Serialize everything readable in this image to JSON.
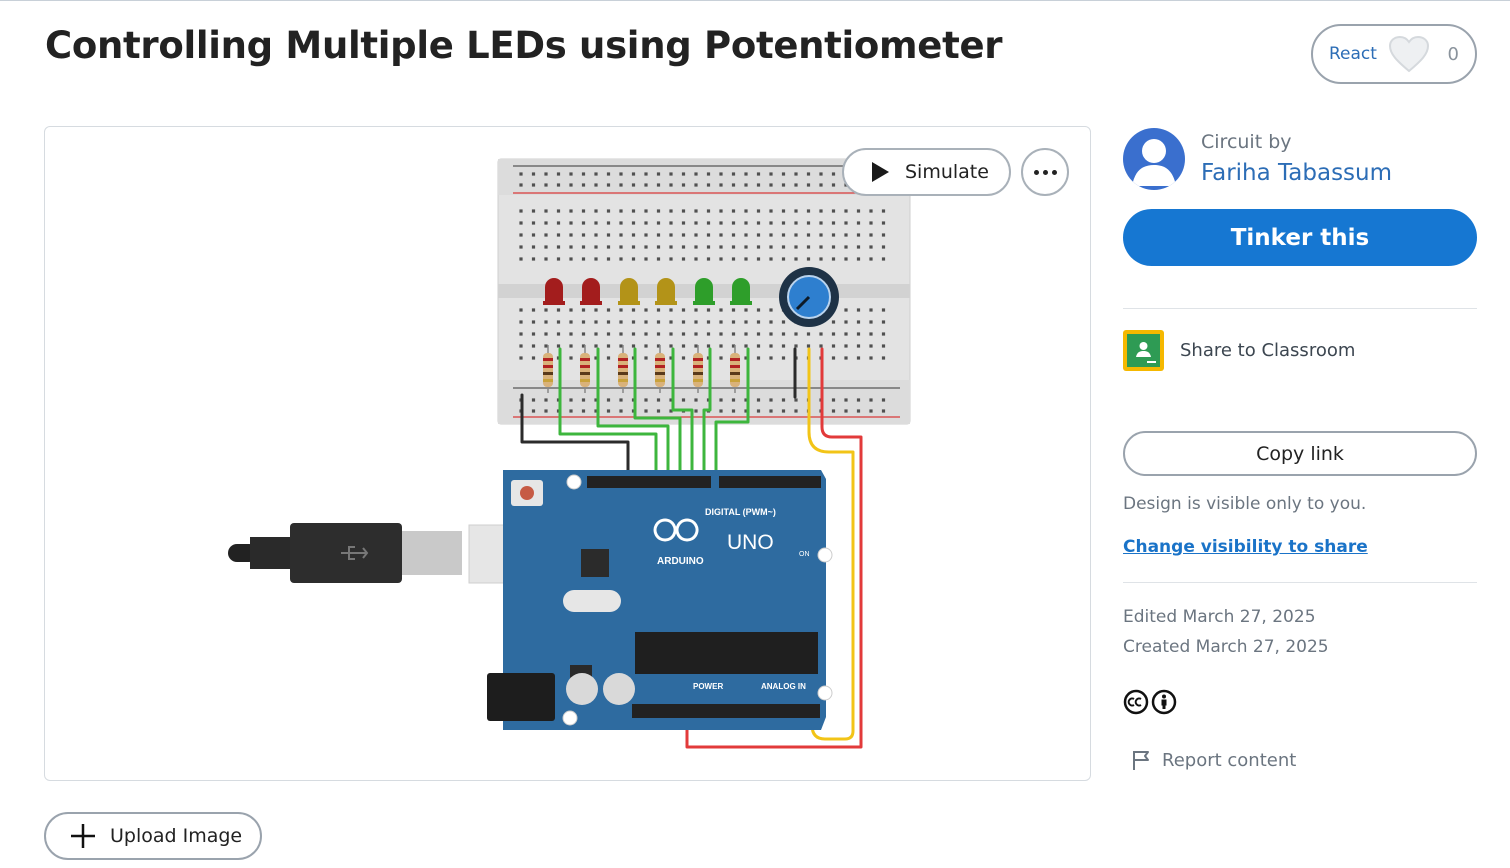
{
  "page": {
    "title": "Controlling Multiple LEDs using Potentiometer"
  },
  "react": {
    "label": "React",
    "count": "0"
  },
  "canvas": {
    "simulate_label": "Simulate",
    "board_label": "UNO",
    "board_brand": "ARDUINO",
    "digital_label": "DIGITAL (PWM~)",
    "power_label": "POWER",
    "analog_label": "ANALOG IN",
    "on_label": "ON",
    "led_colors": [
      "#a31d1d",
      "#a31d1d",
      "#b39318",
      "#b39318",
      "#2e9e2a",
      "#2e9e2a"
    ],
    "wire_colors": {
      "signal": "#3db63d",
      "ground": "#2b2b2b",
      "power": "#e23a3a",
      "analog": "#f2c417"
    }
  },
  "sidebar": {
    "circuit_by_label": "Circuit by",
    "author_name": "Fariha Tabassum",
    "tinker_label": "Tinker this",
    "classroom_label": "Share to Classroom",
    "copy_link_label": "Copy link",
    "visibility_note": "Design is visible only to you.",
    "visibility_link": "Change visibility to share",
    "edited": "Edited March 27, 2025",
    "created": "Created March 27, 2025",
    "report_label": "Report content"
  },
  "upload": {
    "label": "Upload Image"
  },
  "colors": {
    "accent": "#1677d2",
    "link": "#2c6db6",
    "board": "#2e6ba0",
    "classroom": "#f5b800"
  }
}
